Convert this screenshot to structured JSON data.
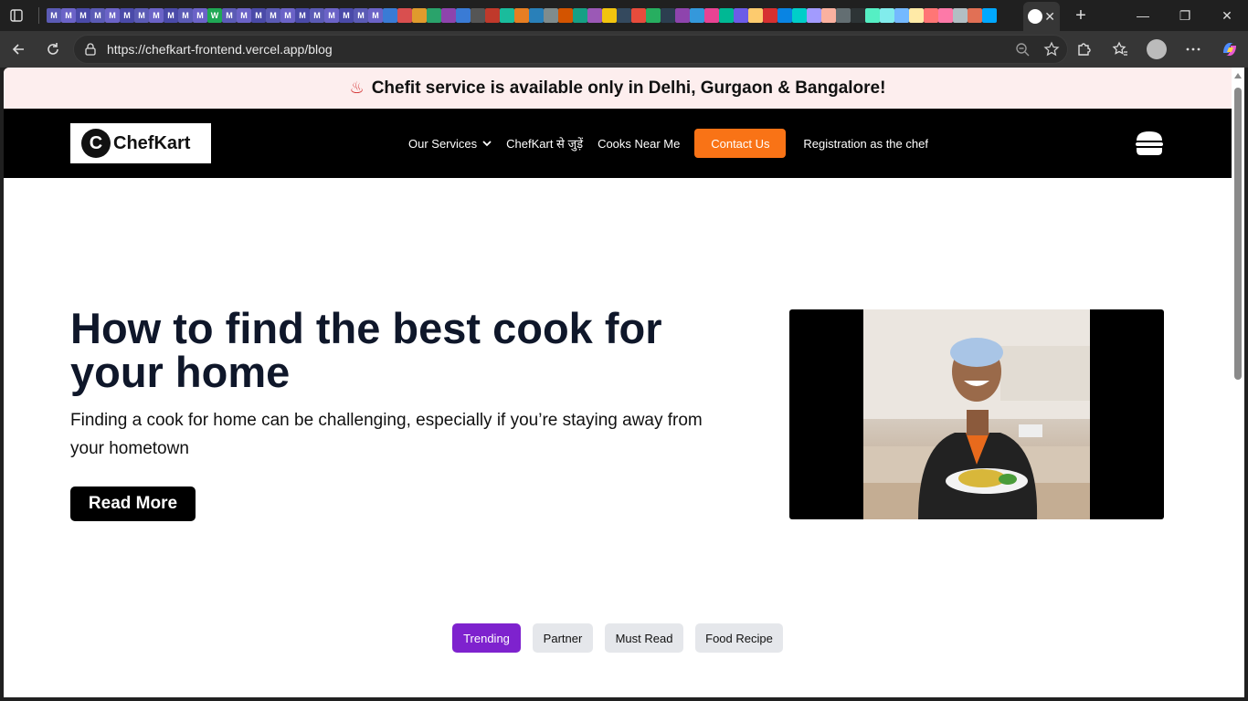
{
  "browser": {
    "url": "https://chefkart-frontend.vercel.app/blog",
    "pinned_tab_labels": [
      "M",
      "M",
      "M",
      "M",
      "M",
      "M",
      "M",
      "M",
      "M",
      "M",
      "M",
      "W",
      "M",
      "M",
      "M",
      "M",
      "M",
      "M",
      "M",
      "M",
      "M",
      "M",
      "M"
    ],
    "new_tab_symbol": "+",
    "close_symbol": "✕"
  },
  "announcement": {
    "icon": "bowl-icon",
    "text": "Chefit service is available only in Delhi, Gurgaon & Bangalore!"
  },
  "nav": {
    "logo_mark": "C",
    "logo_text": "ChefKart",
    "links": {
      "services": "Our Services",
      "join": "ChefKart से जुड़ें",
      "cooks": "Cooks Near Me",
      "contact": "Contact Us",
      "register": "Registration as the chef"
    },
    "colors": {
      "contact_bg": "#f97316",
      "nav_bg": "#000000"
    }
  },
  "hero": {
    "title": "How to find the best cook for your home",
    "subtitle": "Finding a cook for home can be challenging, especially if you’re staying away from your hometown",
    "cta": "Read More"
  },
  "tags": {
    "trending": "Trending",
    "partner": "Partner",
    "must_read": "Must Read",
    "food_recipe": "Food Recipe",
    "active": "Trending",
    "active_color": "#7e22ce"
  }
}
